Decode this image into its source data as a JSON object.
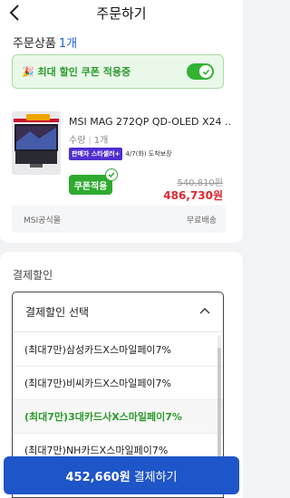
{
  "header": {
    "title": "주문하기",
    "back_icon": "chevron-left-icon"
  },
  "order": {
    "section_label": "주문상품",
    "count": "1개",
    "coupon_banner": "🎉 최대 할인 쿠폰 적용중",
    "coupon_toggle_on": true,
    "product": {
      "name": "MSI MAG 272QP QD-OLED X24 ...",
      "qty_label": "수량",
      "qty_value": "1개",
      "seller_badge": "판매자 스타셀러+",
      "delivery": "4/7(화) 도착보장",
      "coupon_button": "쿠폰적용",
      "original_price": "540,810원",
      "sale_price": "486,730원",
      "seller": "MSI공식몰",
      "shipping": "무료배송"
    }
  },
  "payment_discount": {
    "title": "결제할인",
    "select_label": "결제할인 선택",
    "options": [
      "(최대7만)삼성카드X스마일페이7%",
      "(최대7만)비씨카드X스마일페이7%",
      "(최대7만)3대카드사X스마일페이7%",
      "(최대7만)NH카드X스마일페이7%"
    ],
    "selected_index": 2
  },
  "pay_button": {
    "amount": "452,660원",
    "label": "결제하기"
  },
  "colors": {
    "accent_blue": "#1e55c8",
    "green": "#2eaa2e",
    "price_red": "#e0262f"
  }
}
